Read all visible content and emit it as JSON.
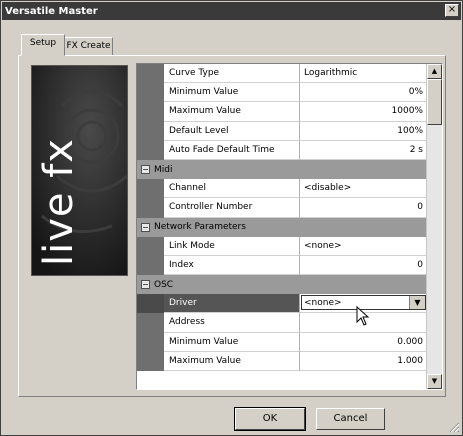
{
  "window": {
    "title": "Versatile Master",
    "close_glyph": "×"
  },
  "tabs": [
    {
      "label": "Setup",
      "active": true
    },
    {
      "label": "FX Create",
      "active": false
    }
  ],
  "logo": {
    "text": "live fx",
    "icon": "livefx-logo-icon"
  },
  "properties": [
    {
      "kind": "row",
      "name": "Curve Type",
      "value": "Logarithmic",
      "align": "left"
    },
    {
      "kind": "row",
      "name": "Minimum Value",
      "value": "0%",
      "align": "right"
    },
    {
      "kind": "row",
      "name": "Maximum Value",
      "value": "1000%",
      "align": "right"
    },
    {
      "kind": "row",
      "name": "Default Level",
      "value": "100%",
      "align": "right"
    },
    {
      "kind": "row",
      "name": "Auto Fade Default Time",
      "value": "2 s",
      "align": "right"
    },
    {
      "kind": "category",
      "name": "Midi",
      "toggle": "−"
    },
    {
      "kind": "row",
      "name": "Channel",
      "value": "<disable>",
      "align": "left"
    },
    {
      "kind": "row",
      "name": "Controller Number",
      "value": "0",
      "align": "right"
    },
    {
      "kind": "category",
      "name": "Network Parameters",
      "toggle": "−"
    },
    {
      "kind": "row",
      "name": "Link Mode",
      "value": "<none>",
      "align": "left"
    },
    {
      "kind": "row",
      "name": "Index",
      "value": "0",
      "align": "right"
    },
    {
      "kind": "category",
      "name": "OSC",
      "toggle": "−"
    },
    {
      "kind": "row",
      "name": "Driver",
      "value": "<none>",
      "align": "left",
      "selected": true,
      "dropdown": true
    },
    {
      "kind": "row",
      "name": "Address",
      "value": "",
      "align": "left"
    },
    {
      "kind": "row",
      "name": "Minimum Value",
      "value": "0.000",
      "align": "right"
    },
    {
      "kind": "row",
      "name": "Maximum Value",
      "value": "1.000",
      "align": "right"
    }
  ],
  "scrollbar": {
    "up_glyph": "▲",
    "down_glyph": "▼"
  },
  "dropdown_glyph": "▼",
  "buttons": {
    "ok": "OK",
    "cancel": "Cancel"
  }
}
